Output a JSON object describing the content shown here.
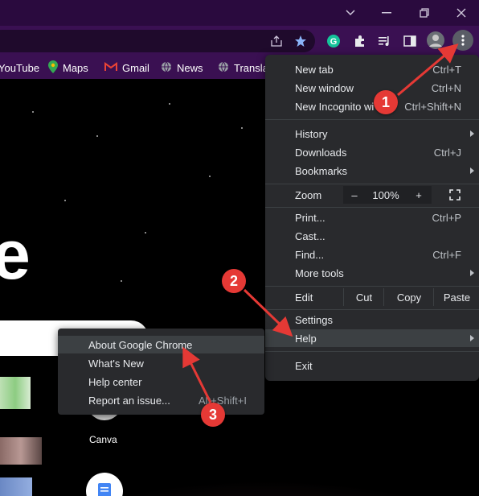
{
  "colors": {
    "accent_red": "#e53935",
    "menu_bg": "#292a2d",
    "toolbar_bg": "#3a1052"
  },
  "bookmarks": [
    {
      "label": "YouTube",
      "icon": "youtube-icon"
    },
    {
      "label": "Maps",
      "icon": "maps-icon"
    },
    {
      "label": "Gmail",
      "icon": "gmail-icon"
    },
    {
      "label": "News",
      "icon": "globe-icon"
    },
    {
      "label": "Transla",
      "icon": "globe-icon"
    }
  ],
  "ntp": {
    "logo_fragment": "e",
    "shortcut_label": "Canva"
  },
  "menu": {
    "new_tab": {
      "label": "New tab",
      "shortcut": "Ctrl+T"
    },
    "new_window": {
      "label": "New window",
      "shortcut": "Ctrl+N"
    },
    "new_incognito": {
      "label": "New Incognito wi",
      "shortcut": "Ctrl+Shift+N"
    },
    "history": {
      "label": "History"
    },
    "downloads": {
      "label": "Downloads",
      "shortcut": "Ctrl+J"
    },
    "bookmarks": {
      "label": "Bookmarks"
    },
    "zoom": {
      "label": "Zoom",
      "minus": "–",
      "value": "100%",
      "plus": "+"
    },
    "print": {
      "label": "Print...",
      "shortcut": "Ctrl+P"
    },
    "cast": {
      "label": "Cast..."
    },
    "find": {
      "label": "Find...",
      "shortcut": "Ctrl+F"
    },
    "more_tools": {
      "label": "More tools"
    },
    "edit": {
      "label": "Edit",
      "cut": "Cut",
      "copy": "Copy",
      "paste": "Paste"
    },
    "settings": {
      "label": "Settings"
    },
    "help": {
      "label": "Help"
    },
    "exit": {
      "label": "Exit"
    }
  },
  "help_submenu": {
    "about": {
      "label": "About Google Chrome"
    },
    "whats_new": {
      "label": "What's New"
    },
    "help_center": {
      "label": "Help center"
    },
    "report": {
      "label": "Report an issue...",
      "shortcut": "Alt+Shift+I"
    }
  },
  "annotations": [
    {
      "number": "1"
    },
    {
      "number": "2"
    },
    {
      "number": "3"
    }
  ]
}
